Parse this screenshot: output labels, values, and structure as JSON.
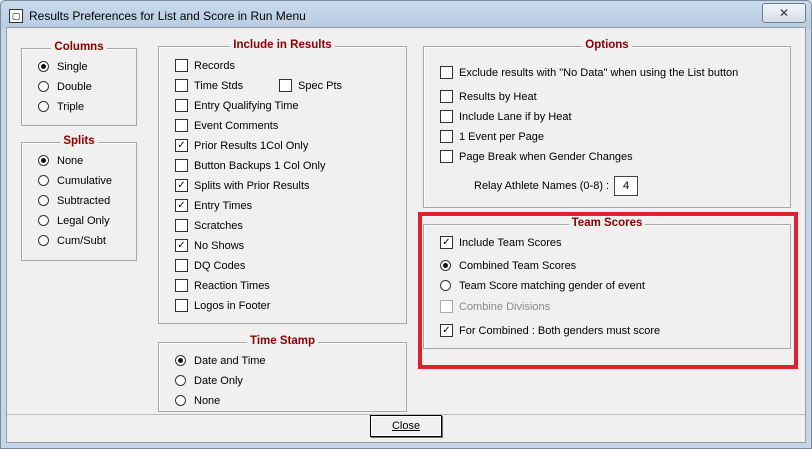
{
  "window": {
    "title": "Results Preferences for List and Score in Run Menu",
    "close_glyph": "✕"
  },
  "columns": {
    "title": "Columns",
    "options": [
      {
        "label": "Single",
        "selected": true
      },
      {
        "label": "Double",
        "selected": false
      },
      {
        "label": "Triple",
        "selected": false
      }
    ]
  },
  "splits": {
    "title": "Splits",
    "options": [
      {
        "label": "None",
        "selected": true
      },
      {
        "label": "Cumulative",
        "selected": false
      },
      {
        "label": "Subtracted",
        "selected": false
      },
      {
        "label": "Legal Only",
        "selected": false
      },
      {
        "label": "Cum/Subt",
        "selected": false
      }
    ]
  },
  "include": {
    "title": "Include in Results",
    "records": {
      "label": "Records",
      "checked": false
    },
    "time_stds": {
      "label": "Time Stds",
      "checked": false
    },
    "spec_pts": {
      "label": "Spec Pts",
      "checked": false
    },
    "entry_qualifying_time": {
      "label": "Entry Qualifying Time",
      "checked": false
    },
    "event_comments": {
      "label": "Event Comments",
      "checked": false
    },
    "prior_results": {
      "label": "Prior Results 1Col Only",
      "checked": true
    },
    "button_backups": {
      "label": "Button Backups 1 Col Only",
      "checked": false
    },
    "splits_prior": {
      "label": "Splits with Prior Results",
      "checked": true
    },
    "entry_times": {
      "label": "Entry Times",
      "checked": true
    },
    "scratches": {
      "label": "Scratches",
      "checked": false
    },
    "no_shows": {
      "label": "No Shows",
      "checked": true
    },
    "dq_codes": {
      "label": "DQ Codes",
      "checked": false
    },
    "reaction_times": {
      "label": "Reaction Times",
      "checked": false
    },
    "logos_footer": {
      "label": "Logos in Footer",
      "checked": false
    }
  },
  "timestamp": {
    "title": "Time Stamp",
    "options": [
      {
        "label": "Date and Time",
        "selected": true
      },
      {
        "label": "Date Only",
        "selected": false
      },
      {
        "label": "None",
        "selected": false
      }
    ]
  },
  "options": {
    "title": "Options",
    "exclude_no_data": {
      "label": "Exclude results with \"No Data\" when using the List button",
      "checked": false
    },
    "results_by_heat": {
      "label": "Results by Heat",
      "checked": false
    },
    "include_lane": {
      "label": "Include Lane if by Heat",
      "checked": false
    },
    "one_event_per_page": {
      "label": "1 Event per Page",
      "checked": false
    },
    "page_break_gender": {
      "label": "Page Break when Gender Changes",
      "checked": false
    },
    "relay_names_label": "Relay Athlete Names (0-8) :",
    "relay_names_value": "4"
  },
  "team_scores": {
    "title": "Team Scores",
    "include": {
      "label": "Include Team Scores",
      "checked": true
    },
    "combined": {
      "label": "Combined Team Scores",
      "selected": true
    },
    "matching_gender": {
      "label": "Team Score matching gender of event",
      "selected": false
    },
    "combine_divisions": {
      "label": "Combine Divisions",
      "checked": false,
      "disabled": true
    },
    "both_genders": {
      "label": "For Combined : Both genders must score",
      "checked": true
    }
  },
  "buttons": {
    "close_label": "Close"
  },
  "colors": {
    "section_title": "#8b0000",
    "highlight_border": "#e0202a"
  }
}
